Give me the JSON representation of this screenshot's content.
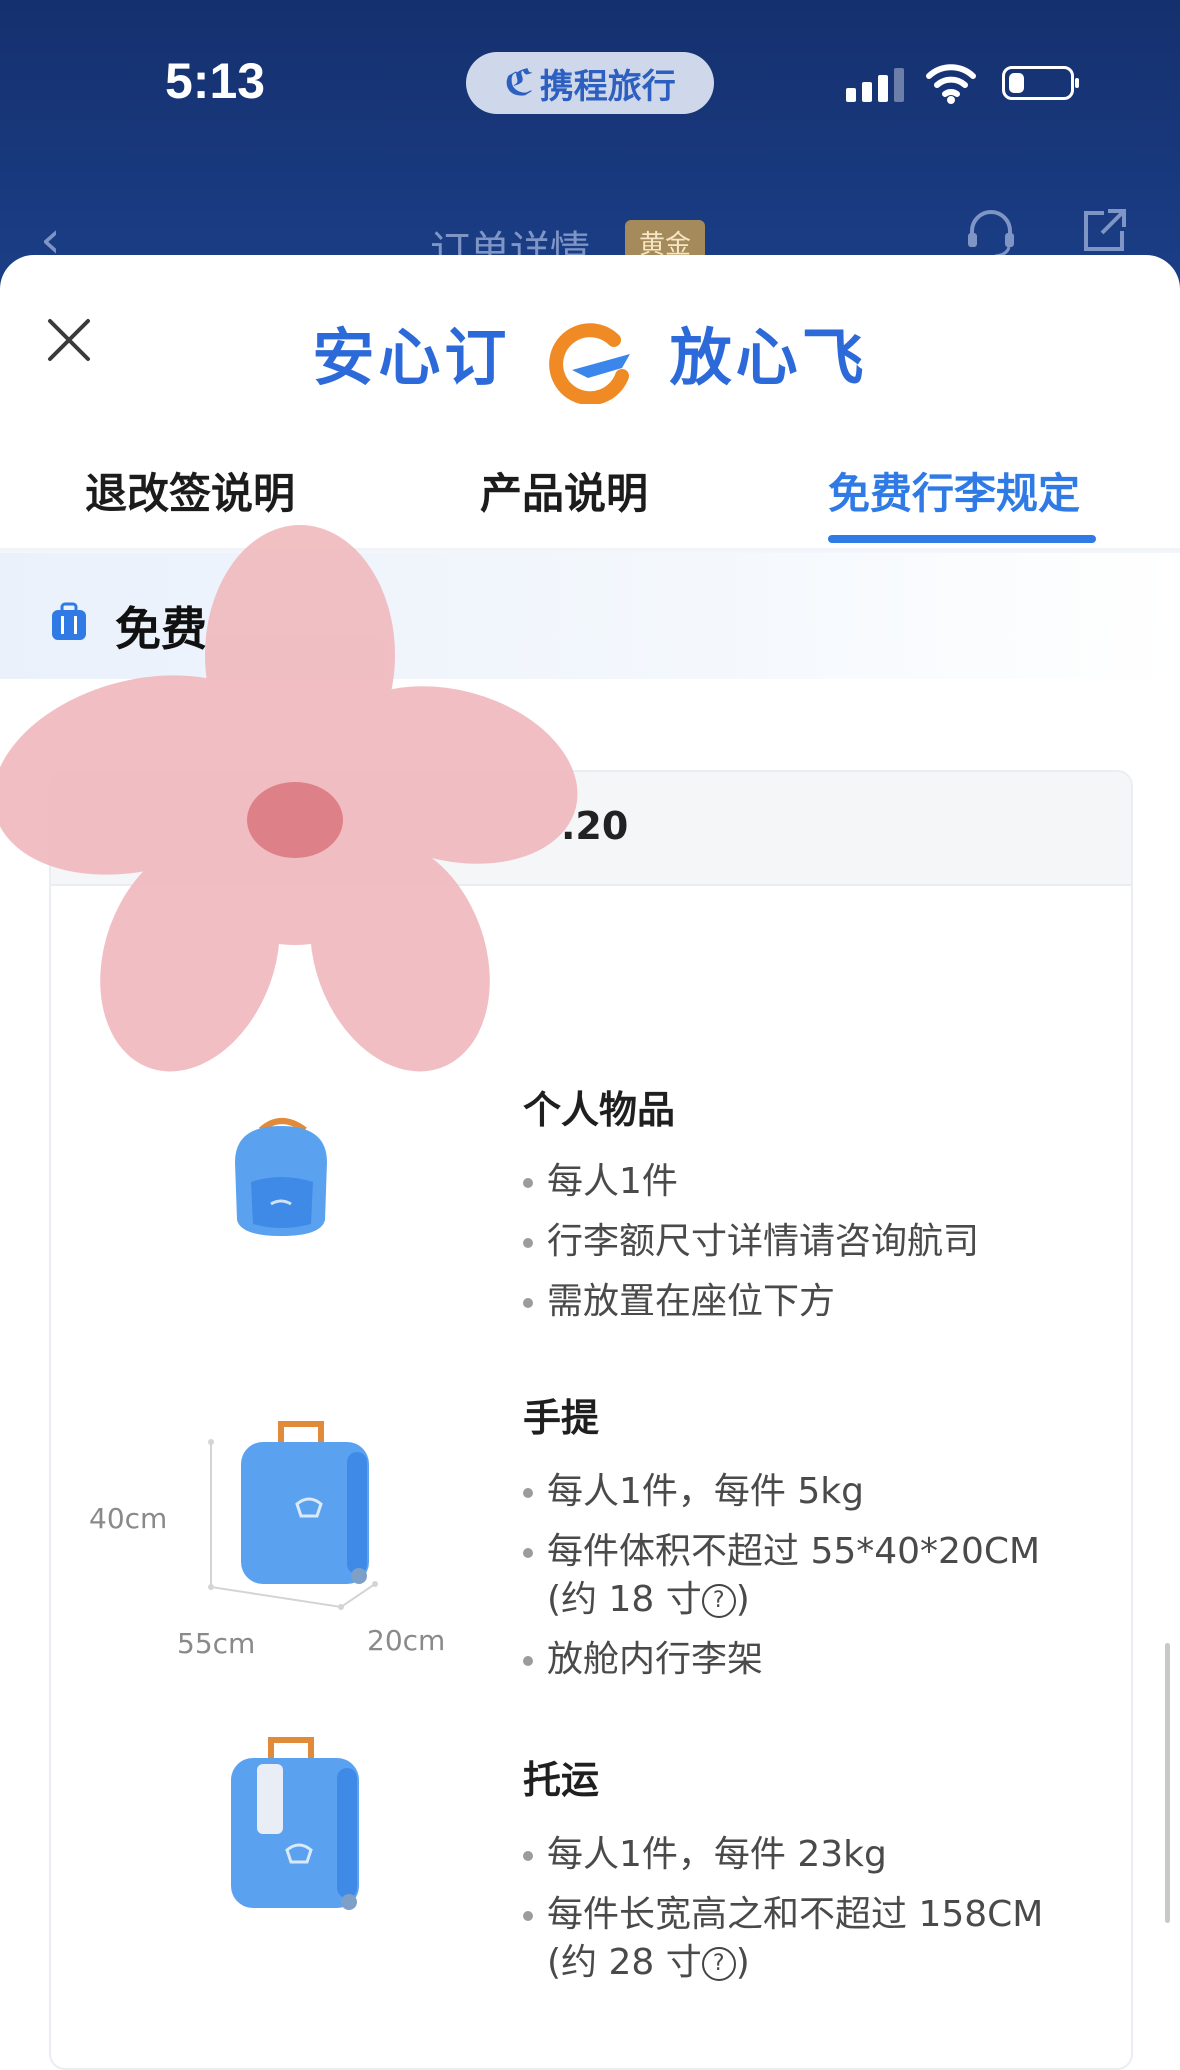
{
  "status_bar": {
    "time": "5:13",
    "app_pill": "携程旅行",
    "battery_level": 0.25
  },
  "nav": {
    "back_icon": "chevron-left-icon",
    "title": "订单详情",
    "badge": "黄金"
  },
  "sheet": {
    "slogan_left": "安心订",
    "slogan_right": "放心飞",
    "tabs": [
      {
        "label": "退改签说明",
        "active": false
      },
      {
        "label": "产品说明",
        "active": false
      },
      {
        "label": "免费行李规定",
        "active": true
      }
    ],
    "section_title": "免费",
    "card": {
      "date_fragment": ".20",
      "items": [
        {
          "icon": "backpack-icon",
          "title": "个人物品",
          "bullets": [
            "每人1件",
            "行李额尺寸详情请咨询航司",
            "需放置在座位下方"
          ]
        },
        {
          "icon": "carry-on-suitcase-icon",
          "title": "手提",
          "bullets": [
            "每人1件，每件 5kg",
            "每件体积不超过 55*40*20CM",
            "(约 18 寸",
            ")",
            "放舱内行李架"
          ],
          "dimensions": {
            "height": "40cm",
            "width": "55cm",
            "depth": "20cm"
          }
        },
        {
          "icon": "checked-suitcase-icon",
          "title": "托运",
          "bullets": [
            "每人1件，每件 23kg",
            "每件长宽高之和不超过 158CM",
            "(约 28 寸",
            ")"
          ]
        }
      ]
    }
  },
  "colors": {
    "header_bg": "#15306e",
    "accent": "#2f7ae5",
    "section_bg": "#eaf1fb"
  }
}
